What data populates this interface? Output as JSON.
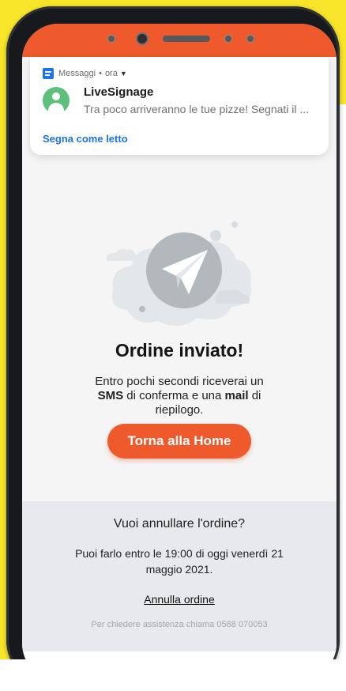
{
  "notification": {
    "app_name": "Messaggi",
    "separator": "•",
    "time": "ora",
    "sender": "LiveSignage",
    "preview": "Tra poco arriveranno le tue pizze! Segnati il ...",
    "action": "Segna come letto"
  },
  "confirmation": {
    "title": "Ordine inviato!",
    "desc_part1": "Entro pochi secondi riceverai un",
    "desc_sms": "SMS",
    "desc_part2": "di conferma e una",
    "desc_mail": "mail",
    "desc_part3": "di riepilogo.",
    "home_button": "Torna alla Home"
  },
  "cancel": {
    "question": "Vuoi annullare l'ordine?",
    "deadline": "Puoi farlo entro le 19:00 di oggi venerdì 21 maggio 2021.",
    "link": "Annulla ordine",
    "support": "Per chiedere assistenza chiama 0588 070053"
  },
  "colors": {
    "accent_orange": "#ee5a2c",
    "background_yellow": "#f8e52a",
    "link_blue": "#1a73e8"
  }
}
